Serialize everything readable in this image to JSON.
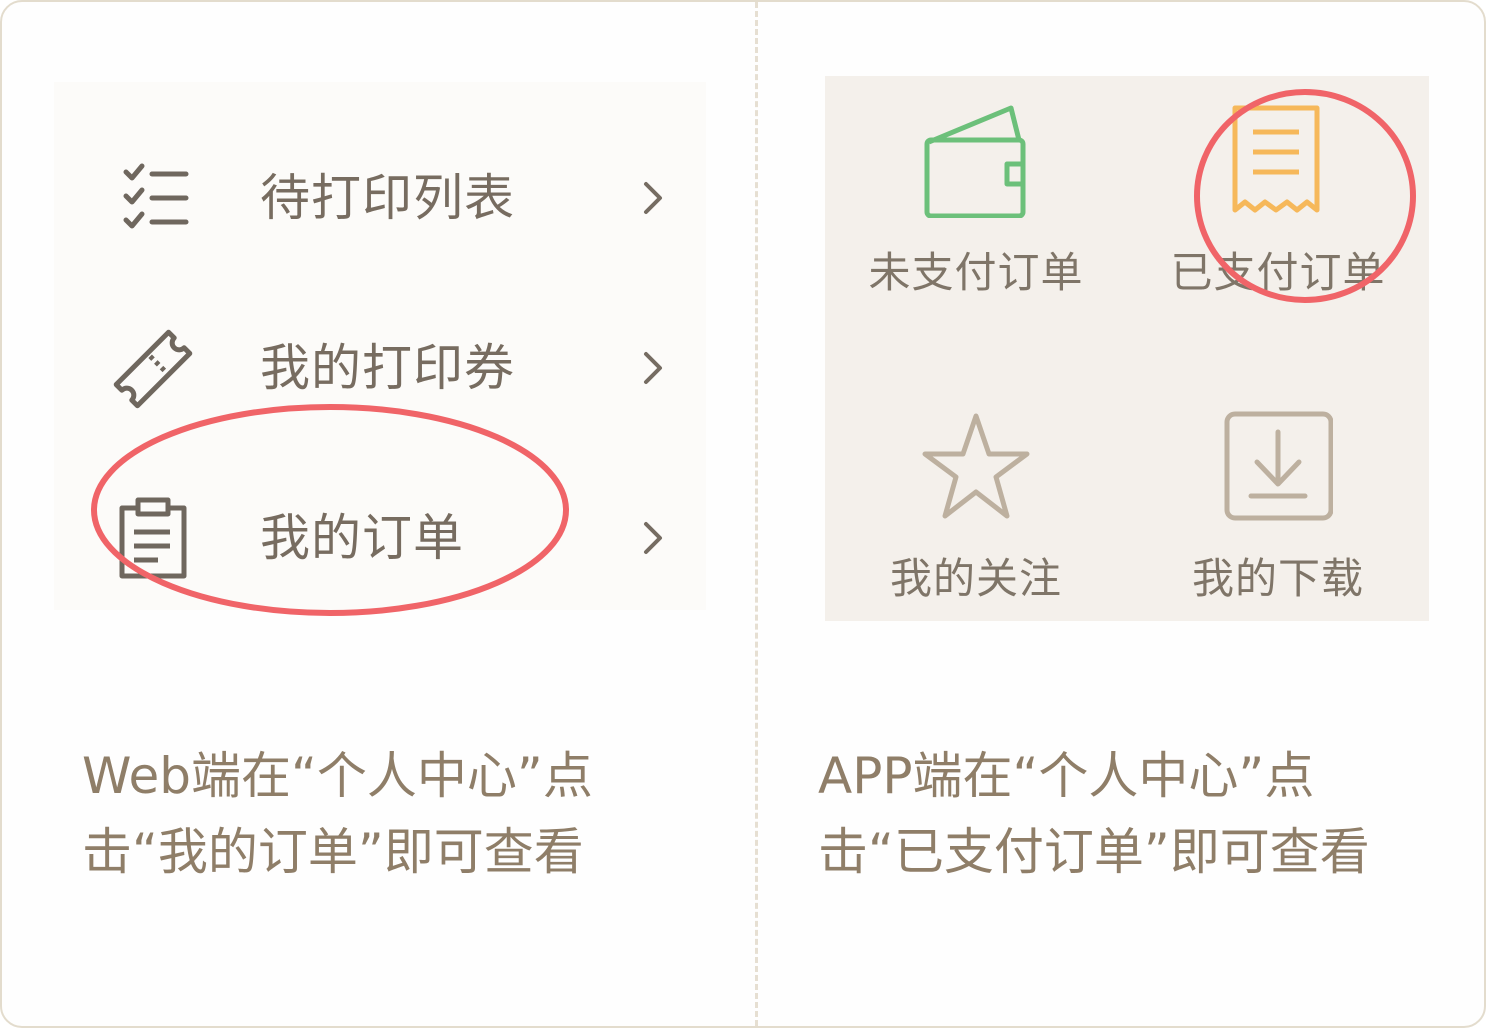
{
  "web": {
    "items": [
      {
        "label": "待打印列表",
        "icon": "checklist-icon"
      },
      {
        "label": "我的打印券",
        "icon": "ticket-icon"
      },
      {
        "label": "我的订单",
        "icon": "clipboard-icon"
      }
    ],
    "caption_line1": "Web端在“个人中心”点",
    "caption_line2": "击“我的订单”即可查看"
  },
  "app": {
    "items": [
      {
        "label": "未支付订单",
        "icon": "wallet-icon"
      },
      {
        "label": "已支付订单",
        "icon": "receipt-icon"
      },
      {
        "label": "我的关注",
        "icon": "star-icon"
      },
      {
        "label": "我的下载",
        "icon": "download-icon"
      }
    ],
    "caption_line1": "APP端在“个人中心”点",
    "caption_line2": "击“已支付订单”即可查看"
  },
  "colors": {
    "text": "#776c60",
    "caption": "#8f7e68",
    "highlight": "#f06468",
    "wallet": "#6cc07a",
    "receipt": "#f6b85a",
    "icon_muted": "#bdb09f"
  }
}
